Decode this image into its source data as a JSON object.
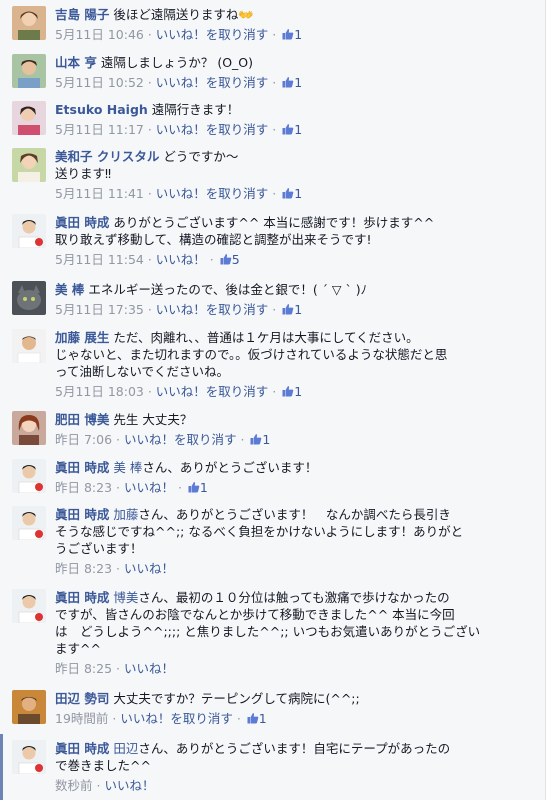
{
  "like_label": "いいね！",
  "unlike_label": "いいね！を取り消す",
  "comments": [
    {
      "name": "吉島 陽子",
      "text": "後ほど遠隔送りますね👐",
      "time": "5月11日 10:46",
      "liked": true,
      "likes": "1"
    },
    {
      "name": "山本 亨",
      "text": "遠隔しましょうか？ (O_O)",
      "time": "5月11日 10:52",
      "liked": true,
      "likes": "1"
    },
    {
      "name": "Etsuko Haigh",
      "text": "遠隔行きます！",
      "time": "5月11日 11:17",
      "liked": true,
      "likes": "1"
    },
    {
      "name": "美和子 クリスタル",
      "text": "どうですか〜",
      "text2": "送ります‼︎",
      "time": "5月11日 11:41",
      "liked": true,
      "likes": "1"
    },
    {
      "name": "眞田 時成",
      "text": "ありがとうございます^^ 本当に感謝です！歩けます^^",
      "text2": "取り敢えず移動して、構造の確認と調整が出来そうです!",
      "time": "5月11日 11:54",
      "liked": false,
      "likes": "5"
    },
    {
      "name": "美 棒",
      "text": "エネルギー送ったので、後は金と銀で！( ´ ▽ ` )ﾉ",
      "time": "5月11日 17:35",
      "liked": true,
      "likes": "1"
    },
    {
      "name": "加藤 展生",
      "text": "ただ、肉離れ、、普通は１ケ月は大事にしてください。",
      "text2": "じゃないと、また切れますので。。仮づけされているような状態だと思",
      "text3": "って油断しないでくださいね。",
      "time": "5月11日 18:03",
      "liked": true,
      "likes": "1"
    },
    {
      "name": "肥田 博美",
      "text": "先生 大丈夫？",
      "time": "昨日 7:06",
      "liked": true,
      "likes": "1"
    },
    {
      "name": "眞田 時成",
      "mention": "美 棒",
      "text": "さん、ありがとうございます！",
      "time": "昨日 8:23",
      "liked": false,
      "likes": "1"
    },
    {
      "name": "眞田 時成",
      "mention": "加藤",
      "text": "さん、ありがとうございます！　なんか調べたら長引き",
      "text2": "そうな感じですね^^;; なるべく負担をかけないようにします！ありがと",
      "text3": "うございます！",
      "time": "昨日 8:23",
      "liked": false,
      "likes": ""
    },
    {
      "name": "眞田 時成",
      "mention": "博美",
      "text": "さん、最初の１０分位は触っても激痛で歩けなかったの",
      "text2": "ですが、皆さんのお陰でなんとか歩けて移動できました^^ 本当に今回",
      "text3": "は　どうしよう^^;;;; と焦りました^^;; いつもお気遣いありがとうござい",
      "text4": "ます^^",
      "time": "昨日 8:25",
      "liked": false,
      "likes": ""
    },
    {
      "name": "田辺 勢司",
      "text": "大丈夫ですか？テーピングして病院に(^^;;",
      "time": "19時間前",
      "liked": true,
      "likes": "1"
    },
    {
      "name": "眞田 時成",
      "mention": "田辺",
      "text": "さん、ありがとうございます！自宅にテープがあったの",
      "text2": "で巻きました^^",
      "time": "数秒前",
      "liked": false,
      "likes": ""
    }
  ],
  "colors": {
    "link": "#3b5998",
    "meta": "#9197a3",
    "text": "#141823",
    "bg": "#f6f7f9"
  }
}
